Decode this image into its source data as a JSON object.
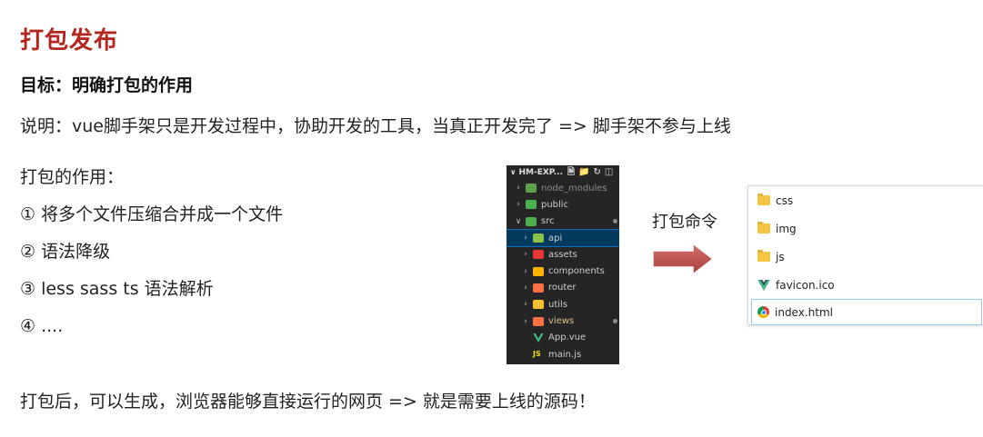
{
  "title": "打包发布",
  "goal": "目标：明确打包的作用",
  "description": "说明：vue脚手架只是开发过程中，协助开发的工具，当真正开发完了  =>  脚手架不参与上线",
  "purpose": {
    "title": "打包的作用：",
    "items": [
      "① 将多个文件压缩合并成一个文件",
      "② 语法降级",
      "③ less sass ts 语法解析",
      "④ ...."
    ]
  },
  "footer": "打包后，可以生成，浏览器能够直接运行的网页   =>   就是需要上线的源码！",
  "arrow_label": "打包命令",
  "explorer": {
    "header": "HM-EXP...",
    "tools": [
      "new-file-icon",
      "new-folder-icon",
      "refresh-icon",
      "collapse-icon"
    ],
    "items": [
      {
        "name": "node_modules",
        "icon": "node-folder-icon",
        "color": "#5fa04e",
        "chevron": ">",
        "indent": 1,
        "dim": true
      },
      {
        "name": "public",
        "icon": "public-folder-icon",
        "color": "#4caf50",
        "chevron": ">",
        "indent": 1
      },
      {
        "name": "src",
        "icon": "src-folder-icon",
        "color": "#4caf50",
        "chevron": "v",
        "indent": 1,
        "dot": true
      },
      {
        "name": "api",
        "icon": "api-folder-icon",
        "color": "#8bc34a",
        "chevron": ">",
        "indent": 2,
        "selected": true
      },
      {
        "name": "assets",
        "icon": "assets-folder-icon",
        "color": "#e53935",
        "chevron": ">",
        "indent": 2
      },
      {
        "name": "components",
        "icon": "components-folder-icon",
        "color": "#ffb300",
        "chevron": ">",
        "indent": 2
      },
      {
        "name": "router",
        "icon": "router-folder-icon",
        "color": "#ff7043",
        "chevron": ">",
        "indent": 2
      },
      {
        "name": "utils",
        "icon": "utils-folder-icon",
        "color": "#fbc02d",
        "chevron": ">",
        "indent": 2
      },
      {
        "name": "views",
        "icon": "views-folder-icon",
        "color": "#ff7043",
        "chevron": ">",
        "indent": 2,
        "orange": true,
        "dot": true
      },
      {
        "name": "App.vue",
        "icon": "vue-file-icon",
        "color": "#41b883",
        "chevron": "",
        "indent": 2
      },
      {
        "name": "main.js",
        "icon": "js-file-icon",
        "color": "#f5de19",
        "chevron": "",
        "indent": 2
      }
    ]
  },
  "files": [
    {
      "name": "css",
      "icon": "folder-icon"
    },
    {
      "name": "img",
      "icon": "folder-icon"
    },
    {
      "name": "js",
      "icon": "folder-icon"
    },
    {
      "name": "favicon.ico",
      "icon": "vue-logo-icon"
    },
    {
      "name": "index.html",
      "icon": "chrome-icon",
      "selected": true
    }
  ],
  "colors": {
    "title": "#b3261e",
    "arrow": "#c0504d",
    "explorer_bg": "#252526",
    "selection": "#04395e"
  }
}
